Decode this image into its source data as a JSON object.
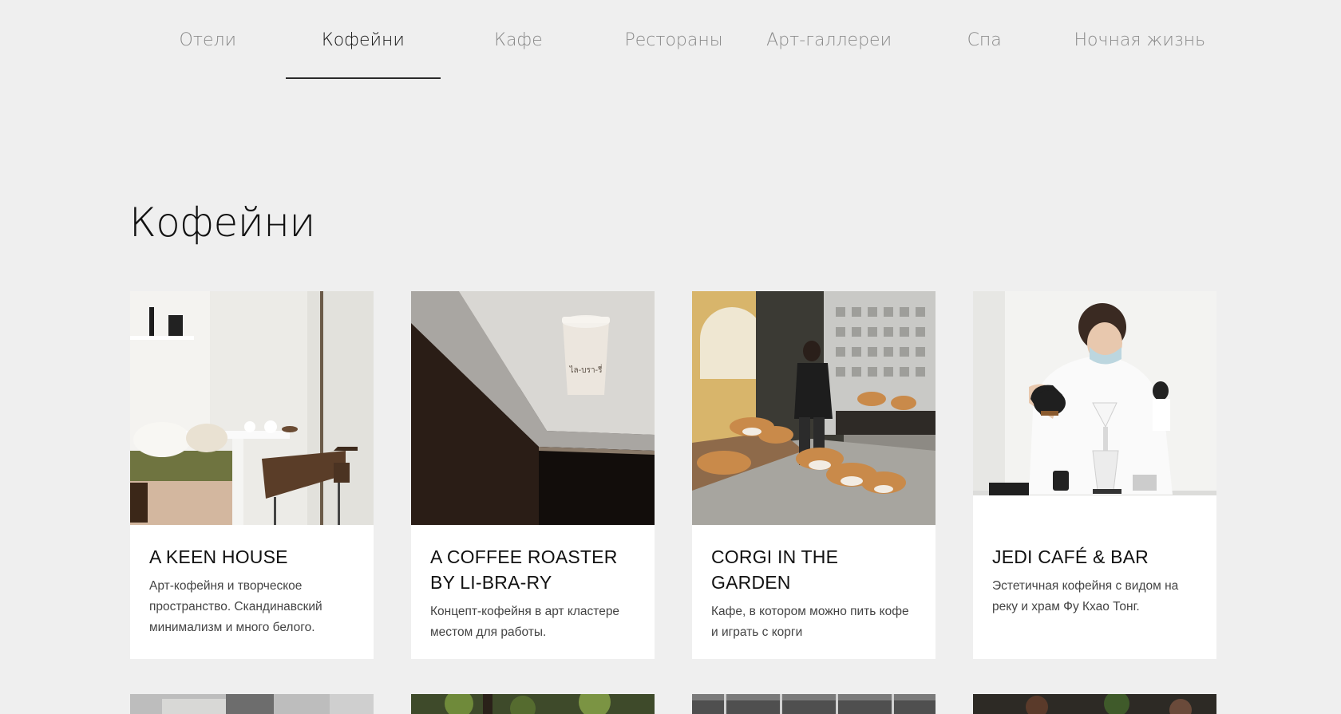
{
  "nav": {
    "items": [
      {
        "label": "Отели"
      },
      {
        "label": "Кофейни",
        "active": true
      },
      {
        "label": "Кафе"
      },
      {
        "label": "Рестораны"
      },
      {
        "label": "Арт-галлереи"
      },
      {
        "label": "Спа"
      },
      {
        "label": "Ночная жизнь"
      }
    ]
  },
  "section": {
    "title": "Кофейни"
  },
  "cards": [
    {
      "title": "A KEEN HOUSE",
      "description": "Арт-кофейня и творческое пространство. Скандинавский минимализм и много белого.",
      "image": "white-scandinavian-interior-photo"
    },
    {
      "title": "A COFFEE ROASTER BY LI-BRA-RY",
      "description": "Концепт-кофейня в арт кластере местом для работы.",
      "image": "coffee-cup-on-counter-photo",
      "cup_label": "ไล-บรา-รี่"
    },
    {
      "title": "CORGI IN THE GARDEN",
      "description": "Кафе, в котором можно пить кофе и играть с корги",
      "image": "woman-with-corgi-dogs-photo"
    },
    {
      "title": "JEDI CAFÉ & BAR",
      "description": "Эстетичная кофейня с видом на реку и храм Фу Кхао Тонг.",
      "image": "barista-pouring-coffee-photo"
    }
  ],
  "colors": {
    "background": "#efefef",
    "card": "#ffffff",
    "nav_inactive": "#8a8a8a",
    "nav_active": "#1a1a1a"
  }
}
